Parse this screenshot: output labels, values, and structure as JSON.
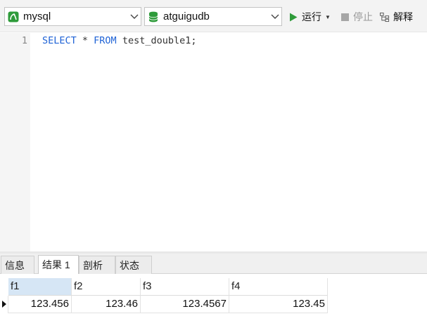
{
  "toolbar": {
    "connection": {
      "value": "mysql",
      "icon": "mysql-connection-icon"
    },
    "database": {
      "value": "atguigudb",
      "icon": "database-icon"
    },
    "run_label": "运行",
    "stop_label": "停止",
    "explain_label": "解释"
  },
  "editor": {
    "line_number": "1",
    "query": {
      "kw_select": "SELECT",
      "star": " * ",
      "kw_from": "FROM",
      "rest": " test_double1;"
    }
  },
  "result_tabs": [
    {
      "label": "信息"
    },
    {
      "label": "结果 1"
    },
    {
      "label": "剖析"
    },
    {
      "label": "状态"
    }
  ],
  "result_grid": {
    "columns": [
      "f1",
      "f2",
      "f3",
      "f4"
    ],
    "rows": [
      [
        "123.456",
        "123.46",
        "123.4567",
        "123.45"
      ]
    ]
  },
  "colors": {
    "keyword": "#1f63d6",
    "run_icon": "#2e9b3a",
    "mysql_icon": "#2e9b3a",
    "database_icon": "#2e9b3a",
    "selected_header": "#d6e6f5"
  }
}
